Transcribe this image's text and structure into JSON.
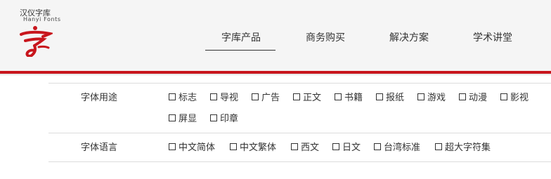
{
  "brand": {
    "name_cn": "汉仪字库",
    "name_en": "Hanyi Fonts"
  },
  "nav": {
    "items": [
      "字库产品",
      "商务购买",
      "解决方案",
      "学术讲堂"
    ],
    "active": "字库产品"
  },
  "filters": {
    "usage": {
      "label": "字体用途",
      "options": [
        "标志",
        "导视",
        "广告",
        "正文",
        "书籍",
        "报纸",
        "游戏",
        "动漫",
        "影视",
        "屏显",
        "印章"
      ]
    },
    "language": {
      "label": "字体语言",
      "options": [
        "中文简体",
        "中文繁体",
        "西文",
        "日文",
        "台湾标准",
        "超大字符集"
      ]
    }
  },
  "colors": {
    "brand_red": "#c8161d",
    "header_bg": "#f5f5f5",
    "rule": "#dcdcdc"
  }
}
